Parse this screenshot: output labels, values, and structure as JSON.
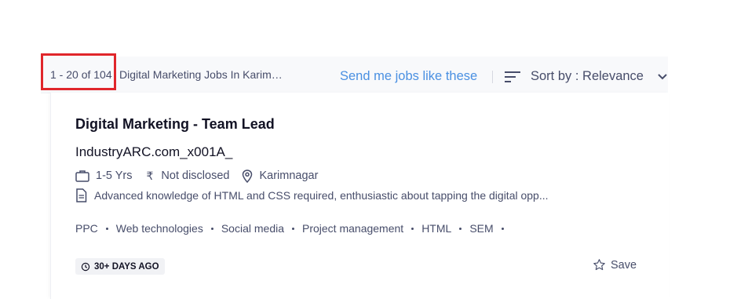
{
  "results_bar": {
    "count_text": "1 - 20 of 104",
    "query_text": "Digital Marketing Jobs In Karimnagar",
    "send_jobs_label": "Send me jobs like these",
    "sort_label": "Sort by : Relevance"
  },
  "job": {
    "title": "Digital Marketing - Team Lead",
    "company": "IndustryARC.com_x001A_",
    "experience": "1-5 Yrs",
    "salary": "Not disclosed",
    "location": "Karimnagar",
    "description": "Advanced knowledge of HTML and CSS required, enthusiastic about tapping the digital opp...",
    "tags": [
      "PPC",
      "Web technologies",
      "Social media",
      "Project management",
      "HTML",
      "SEM"
    ],
    "posted": "30+ DAYS AGO",
    "save_label": "Save"
  },
  "icons": {
    "sort": "sort-icon",
    "chevron": "chevron-down-icon",
    "experience": "briefcase-icon",
    "salary": "rupee-icon",
    "location": "location-pin-icon",
    "description": "document-icon",
    "posted": "history-icon",
    "save": "star-icon"
  },
  "colors": {
    "link_blue": "#4a90e2",
    "highlight_red": "#e0262b",
    "text_dark": "#121224",
    "text_muted": "#474d6a"
  }
}
